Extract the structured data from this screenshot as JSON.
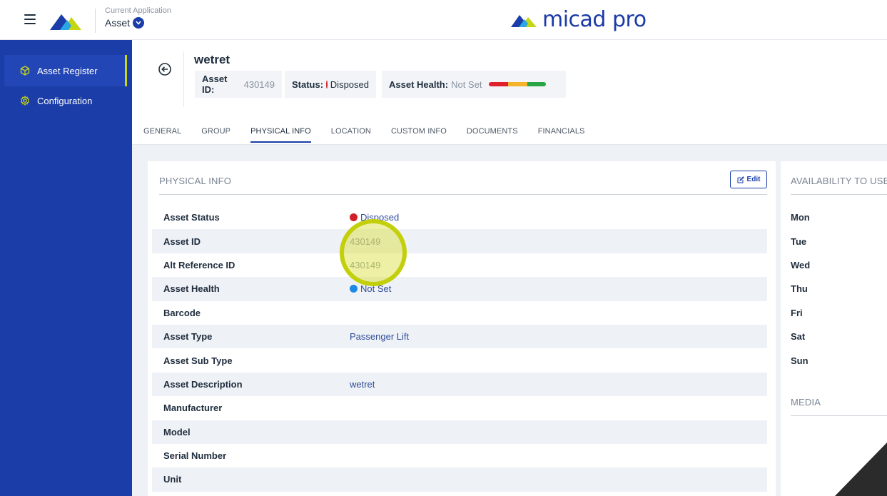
{
  "header": {
    "app_label": "Current Application",
    "app_value": "Asset",
    "brand": "micad pro",
    "colors": {
      "brand_blue": "#1a3aa6",
      "brand_accent": "#c6d614"
    }
  },
  "sidebar": {
    "items": [
      {
        "label": "Asset Register",
        "icon": "cube-icon",
        "active": true
      },
      {
        "label": "Configuration",
        "icon": "gear-icon",
        "active": false
      }
    ]
  },
  "asset": {
    "name": "wetret",
    "id_label": "Asset ID:",
    "id_value": "430149",
    "status_label": "Status:",
    "status_value": "Disposed",
    "health_label": "Asset Health:",
    "health_value": "Not Set"
  },
  "tabs": [
    "GENERAL",
    "GROUP",
    "PHYSICAL INFO",
    "LOCATION",
    "CUSTOM INFO",
    "DOCUMENTS",
    "FINANCIALS"
  ],
  "physical_info": {
    "title": "PHYSICAL INFO",
    "edit_label": "Edit",
    "rows": [
      {
        "label": "Asset Status",
        "value": "Disposed",
        "dot": "#d11f2a"
      },
      {
        "label": "Asset ID",
        "value": "430149"
      },
      {
        "label": "Alt Reference ID",
        "value": "430149"
      },
      {
        "label": "Asset Health",
        "value": "Not Set",
        "dot": "#1e88e5"
      },
      {
        "label": "Barcode",
        "value": ""
      },
      {
        "label": "Asset Type",
        "value": "Passenger Lift"
      },
      {
        "label": "Asset Sub Type",
        "value": ""
      },
      {
        "label": "Asset Description",
        "value": "wetret"
      },
      {
        "label": "Manufacturer",
        "value": ""
      },
      {
        "label": "Model",
        "value": ""
      },
      {
        "label": "Serial Number",
        "value": ""
      },
      {
        "label": "Unit",
        "value": ""
      }
    ]
  },
  "availability": {
    "title": "AVAILABILITY TO USE",
    "days": [
      "Mon",
      "Tue",
      "Wed",
      "Thu",
      "Fri",
      "Sat",
      "Sun"
    ]
  },
  "media": {
    "title": "MEDIA"
  }
}
